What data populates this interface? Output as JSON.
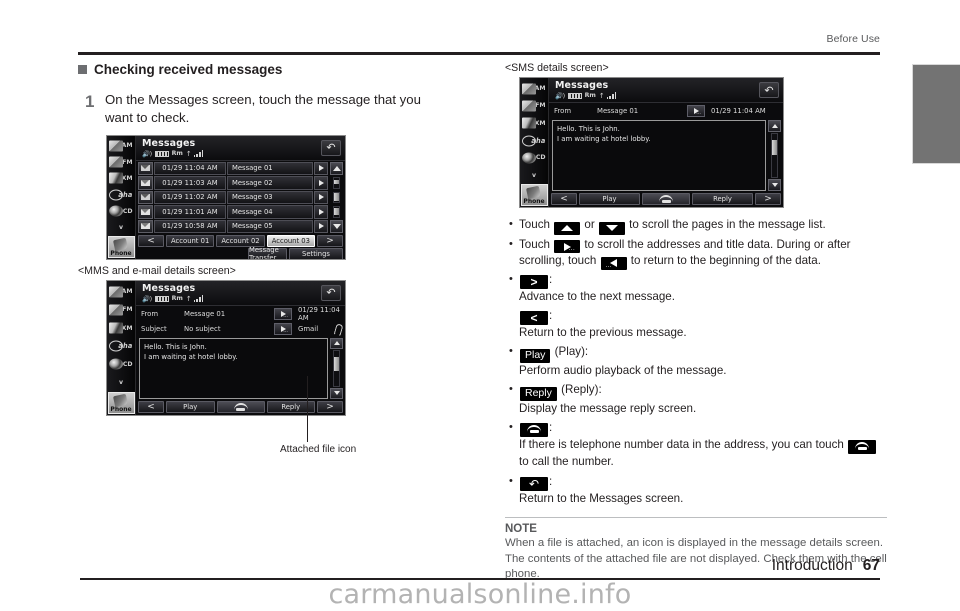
{
  "header": {
    "section_label": "Before Use"
  },
  "footer": {
    "chapter": "Introduction",
    "page_number": "67",
    "watermark": "carmanualsonline.info"
  },
  "left_column": {
    "section_heading": "Checking received messages",
    "step": {
      "number": "1",
      "text": "On the Messages screen, touch the message that you want to check."
    },
    "message_list_screen": {
      "title": "Messages",
      "status_icons": [
        "speaker-icon",
        "battery-icon",
        "Rm",
        "signal-bars-icon"
      ],
      "roaming_label": "Rm",
      "side_buttons": [
        "AM",
        "FM",
        "XM",
        "aha",
        "CD",
        "v",
        "Phone"
      ],
      "rows": [
        {
          "icon": "envelope-open-icon",
          "date": "01/29 11:04 AM",
          "title": "Message 01",
          "scroll": "scroll-right-icon"
        },
        {
          "icon": "envelope-closed-icon",
          "date": "01/29 11:03 AM",
          "title": "Message 02",
          "scroll": "scroll-right-icon"
        },
        {
          "icon": "envelope-open-icon",
          "date": "01/29 11:02 AM",
          "title": "Message 03",
          "scroll": "scroll-right-icon"
        },
        {
          "icon": "envelope-closed-icon",
          "date": "01/29 11:01 AM",
          "title": "Message 04",
          "scroll": "scroll-right-icon"
        },
        {
          "icon": "envelope-closed-icon",
          "date": "01/29 10:58 AM",
          "title": "Message 05",
          "scroll": "scroll-right-icon"
        }
      ],
      "tabs": {
        "prev": "<",
        "next": ">",
        "accounts": [
          "Account 01",
          "Account 02",
          "Account 03"
        ],
        "selected_account": "Account 03"
      },
      "bottom_buttons": [
        "Message Transfer",
        "Settings"
      ],
      "back_button": "return-arrow-icon"
    },
    "mms_caption": "<MMS and e-mail details screen>",
    "mms_screen": {
      "title": "Messages",
      "roaming_label": "Rm",
      "rows": [
        {
          "label": "From",
          "value": "Message 01",
          "right": "01/29  11:04 AM"
        },
        {
          "label": "Subject",
          "value": "No subject",
          "right": "Gmail"
        }
      ],
      "body_lines": [
        "Hello. This is John.",
        "I am waiting at hotel lobby."
      ],
      "bottom_buttons": [
        "<",
        "Play",
        "call-icon",
        "Reply",
        ">"
      ],
      "attachment_icon": "paperclip-icon"
    },
    "callout": "Attached file icon"
  },
  "right_column": {
    "sms_caption": "<SMS details screen>",
    "sms_screen": {
      "title": "Messages",
      "roaming_label": "Rm",
      "row": {
        "label": "From",
        "value": "Message 01",
        "right": "01/29  11:04 AM"
      },
      "body_lines": [
        "Hello. This is John.",
        "I am waiting at hotel lobby."
      ],
      "bottom_buttons": [
        "<",
        "Play",
        "call-icon",
        "Reply",
        ">"
      ]
    },
    "bullets": [
      {
        "parts": [
          {
            "type": "text",
            "value": "Touch "
          },
          {
            "type": "key",
            "glyph": "up-triangle-icon"
          },
          {
            "type": "text",
            "value": " or "
          },
          {
            "type": "key",
            "glyph": "down-triangle-icon"
          },
          {
            "type": "text",
            "value": " to scroll the pages in the message list."
          }
        ]
      },
      {
        "parts": [
          {
            "type": "text",
            "value": "Touch "
          },
          {
            "type": "key",
            "glyph": "scroll-right-icon"
          },
          {
            "type": "text",
            "value": " to scroll the addresses and title data. During or after scrolling, touch "
          },
          {
            "type": "key",
            "glyph": "scroll-left-icon"
          },
          {
            "type": "text",
            "value": " to return to the beginning of the data."
          }
        ]
      }
    ],
    "key_descriptions": [
      {
        "key": "next-chevron-icon",
        "key_label": ">",
        "suffix": ":",
        "desc": "Advance to the next message.",
        "grouped": true
      },
      {
        "key": "prev-chevron-icon",
        "key_label": "<",
        "suffix": ":",
        "desc": "Return to the previous message.",
        "grouped": false
      },
      {
        "key": "play-button",
        "key_label": "Play",
        "suffix": " (Play):",
        "desc": "Perform audio playback of the message.",
        "grouped": true
      },
      {
        "key": "reply-button",
        "key_label": "Reply",
        "suffix": " (Reply):",
        "desc": "Display the message reply screen.",
        "grouped": true
      }
    ],
    "call_item": {
      "suffix": ":",
      "desc_before": "If there is telephone number data in the address, you can touch ",
      "desc_after": " to call the number."
    },
    "return_item": {
      "suffix": ":",
      "desc": "Return to the Messages screen."
    },
    "note": {
      "title": "NOTE",
      "body": "When a file is attached, an icon is displayed in the message details screen. The contents of the attached file are not displayed. Check them with the cell phone."
    }
  }
}
